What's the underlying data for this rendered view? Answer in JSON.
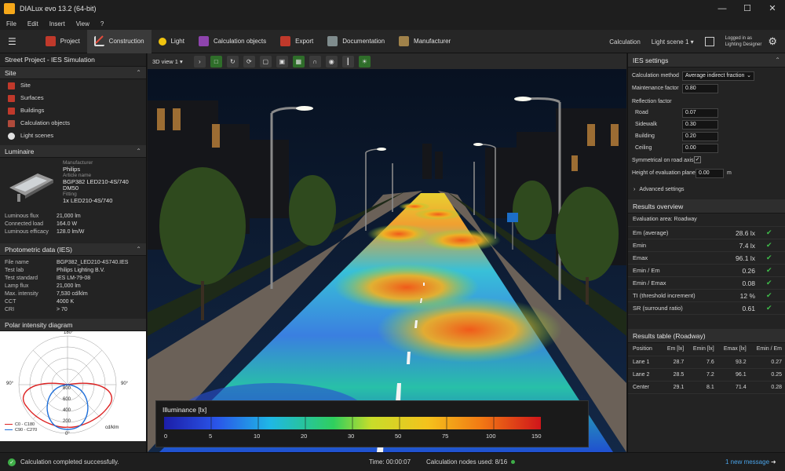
{
  "window": {
    "title": "DIALux evo 13.2 (64-bit)"
  },
  "menu": [
    "File",
    "Edit",
    "Insert",
    "View",
    "?"
  ],
  "ribbon": {
    "tabs": [
      "Project",
      "Construction",
      "Light",
      "Calculation objects",
      "Export",
      "Documentation",
      "Manufacturer"
    ],
    "calculation_label": "Calculation",
    "light_scene": "Light scene 1",
    "login_line1": "Logged in as",
    "login_line2": "Lighting Designer"
  },
  "left": {
    "project_title": "Street Project - IES Simulation",
    "site": {
      "title": "Site",
      "items": [
        "Site",
        "Surfaces",
        "Buildings",
        "Calculation objects",
        "Light scenes"
      ]
    },
    "luminaire": {
      "title": "Luminaire",
      "manufacturer_label": "Manufacturer",
      "manufacturer": "Philips",
      "article_label": "Article name",
      "article": "BGP382 LED210-4S/740 DM50",
      "fitting_label": "Fitting",
      "fitting": "1x LED210-4S/740",
      "props": [
        {
          "k": "Luminous flux",
          "v": "21,000 lm"
        },
        {
          "k": "Connected load",
          "v": "164.0 W"
        },
        {
          "k": "Luminous efficacy",
          "v": "128.0 lm/W"
        }
      ]
    },
    "photometric": {
      "title": "Photometric data (IES)",
      "props": [
        {
          "k": "File name",
          "v": "BGP382_LED210-4S740.IES"
        },
        {
          "k": "Test lab",
          "v": "Philips Lighting B.V."
        },
        {
          "k": "Test standard",
          "v": "IES LM-79-08"
        },
        {
          "k": "Lamp flux",
          "v": "21,000 lm"
        },
        {
          "k": "Max. intensity",
          "v": "7,530 cd/klm"
        },
        {
          "k": "CCT",
          "v": "4000 K"
        },
        {
          "k": "CRI",
          "v": "> 70"
        }
      ]
    },
    "polar": {
      "title": "Polar intensity diagram",
      "angle_top": "180°",
      "angle_left": "90°",
      "angle_right": "90°",
      "angle_bottom": "0°",
      "rings": [
        "800",
        "600",
        "400",
        "200"
      ],
      "legend": [
        "C0 - C180",
        "C90 - C270"
      ],
      "unit": "cd/klm"
    }
  },
  "viewport": {
    "view_label": "3D view 1",
    "legend_title": "Illuminance [lx]",
    "legend_ticks": [
      "0",
      "5",
      "10",
      "20",
      "30",
      "50",
      "75",
      "100",
      "150"
    ]
  },
  "ies": {
    "title": "IES settings",
    "calc_method_label": "Calculation method",
    "calc_method": "Average indirect fraction",
    "maint_label": "Maintenance factor",
    "maint": "0.80",
    "refl_label": "Reflection factor",
    "refl": [
      {
        "k": "Road",
        "v": "0.07"
      },
      {
        "k": "Sidewalk",
        "v": "0.30"
      },
      {
        "k": "Building",
        "v": "0.20"
      },
      {
        "k": "Ceiling",
        "v": "0.00"
      }
    ],
    "symmetrical_label": "Symmetrical on road axis",
    "height_label": "Height of evaluation plane",
    "height": "0.00",
    "height_unit": "m",
    "advanced": "Advanced settings"
  },
  "results": {
    "title": "Results overview",
    "area": "Evaluation area: Roadway",
    "rows": [
      {
        "k": "Em (average)",
        "v": "28.6",
        "u": "lx"
      },
      {
        "k": "Emin",
        "v": "7.4",
        "u": "lx"
      },
      {
        "k": "Emax",
        "v": "96.1",
        "u": "lx"
      },
      {
        "k": "Emin / Em",
        "v": "0.26",
        "u": ""
      },
      {
        "k": "Emin / Emax",
        "v": "0.08",
        "u": ""
      },
      {
        "k": "TI (threshold increment)",
        "v": "12",
        "u": "%"
      },
      {
        "k": "SR (surround ratio)",
        "v": "0.61",
        "u": ""
      }
    ]
  },
  "table": {
    "title": "Results table (Roadway)",
    "headers": [
      "Position",
      "Em [lx]",
      "Emin [lx]",
      "Emax [lx]",
      "Emin / Em"
    ],
    "rows": [
      [
        "Lane 1",
        "28.7",
        "7.6",
        "93.2",
        "0.27"
      ],
      [
        "Lane 2",
        "28.5",
        "7.2",
        "96.1",
        "0.25"
      ],
      [
        "Center",
        "29.1",
        "8.1",
        "71.4",
        "0.28"
      ]
    ]
  },
  "status": {
    "message": "Calculation completed successfully.",
    "time": "Time: 00:00:07",
    "nodes": "Calculation nodes used: 8/16",
    "new_message": "1 new message"
  }
}
